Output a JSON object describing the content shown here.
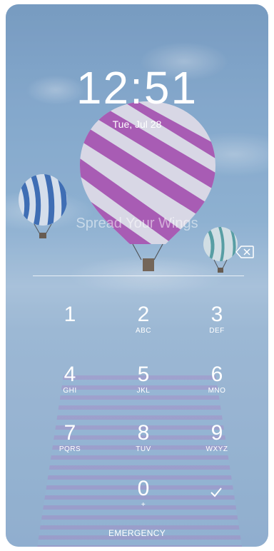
{
  "lockscreen": {
    "time": "12:51",
    "date": "Tue, Jul 28",
    "wallpaper_text": "Spread Your Wings",
    "emergency_label": "EMERGENCY"
  },
  "keypad": {
    "keys": [
      {
        "digit": "1",
        "letters": ""
      },
      {
        "digit": "2",
        "letters": "ABC"
      },
      {
        "digit": "3",
        "letters": "DEF"
      },
      {
        "digit": "4",
        "letters": "GHI"
      },
      {
        "digit": "5",
        "letters": "JKL"
      },
      {
        "digit": "6",
        "letters": "MNO"
      },
      {
        "digit": "7",
        "letters": "PQRS"
      },
      {
        "digit": "8",
        "letters": "TUV"
      },
      {
        "digit": "9",
        "letters": "WXYZ"
      },
      {
        "digit": "0",
        "letters": "+"
      }
    ]
  },
  "icons": {
    "backspace": "backspace-icon",
    "confirm": "checkmark-icon"
  },
  "colors": {
    "sky": "#8cb0d2",
    "balloon_pink": "#b14fb4",
    "balloon_blue": "#3e6fb8",
    "balloon_teal": "#5aa6a5",
    "text": "#ffffff"
  }
}
